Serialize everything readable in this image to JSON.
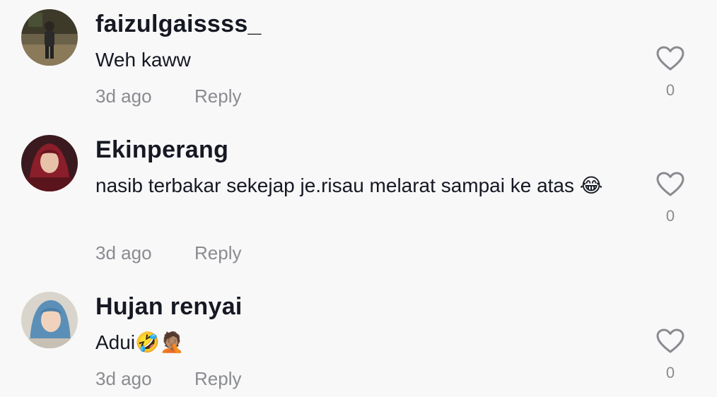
{
  "comments": [
    {
      "username": "faizulgaissss_",
      "text": "Weh kaww",
      "time": "3d ago",
      "reply_label": "Reply",
      "likes": "0",
      "avatar_icon": "avatar-photo-icon"
    },
    {
      "username": "Ekinperang",
      "text": "nasib terbakar sekejap je.risau melarat sampai ke atas 😂",
      "time": "3d ago",
      "reply_label": "Reply",
      "likes": "0",
      "avatar_icon": "avatar-photo-icon"
    },
    {
      "username": "Hujan renyai",
      "text": "Adui🤣🤦🏽",
      "time": "3d ago",
      "reply_label": "Reply",
      "likes": "0",
      "avatar_icon": "avatar-photo-icon"
    }
  ],
  "colors": {
    "background": "#f8f8f8",
    "primary_text": "#161823",
    "secondary_text": "#8a8b91"
  }
}
